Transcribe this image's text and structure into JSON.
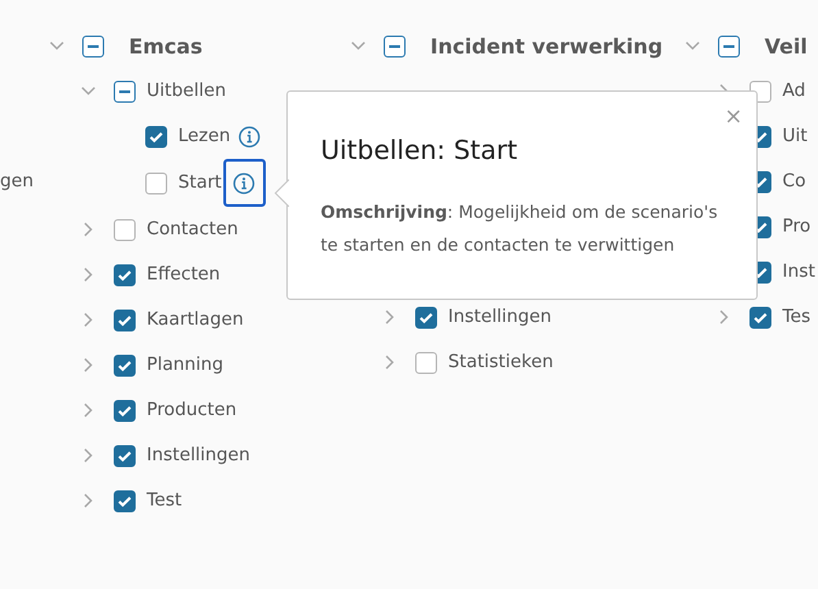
{
  "columns": [
    {
      "items": [
        {
          "label": "gen"
        }
      ]
    },
    {
      "items": [
        {
          "label": "Emcas",
          "indeterminate": true,
          "expanded": true,
          "children": [
            {
              "label": "Uitbellen",
              "indeterminate": true,
              "expanded": true,
              "children": [
                {
                  "label": "Lezen",
                  "checked": true,
                  "info": true,
                  "focused": false
                },
                {
                  "label": "Start",
                  "checked": false,
                  "info": true,
                  "focused": true
                }
              ]
            },
            {
              "label": "Contacten",
              "checked": false,
              "expanded": false
            },
            {
              "label": "Effecten",
              "checked": true,
              "expanded": false
            },
            {
              "label": "Kaartlagen",
              "checked": true,
              "expanded": false
            },
            {
              "label": "Planning",
              "checked": true,
              "expanded": false
            },
            {
              "label": "Producten",
              "checked": true,
              "expanded": false
            },
            {
              "label": "Instellingen",
              "checked": true,
              "expanded": false
            },
            {
              "label": "Test",
              "checked": true,
              "expanded": false
            }
          ]
        }
      ]
    },
    {
      "items": [
        {
          "label": "Incident verwerking",
          "indeterminate": true,
          "expanded": true,
          "children": [
            {
              "label": "Instellingen",
              "checked": true,
              "expanded": false
            },
            {
              "label": "Statistieken",
              "checked": false,
              "expanded": false
            }
          ]
        }
      ]
    },
    {
      "items": [
        {
          "label": "Veil",
          "indeterminate": true,
          "expanded": true,
          "children": [
            {
              "label": "Ad",
              "checked": false,
              "expanded": false
            },
            {
              "label": "Uit",
              "checked": true
            },
            {
              "label": "Co",
              "checked": true
            },
            {
              "label": "Pro",
              "checked": true
            },
            {
              "label": "Inst",
              "checked": true
            },
            {
              "label": "Tes",
              "checked": true,
              "expanded": false
            }
          ]
        }
      ]
    }
  ],
  "popover": {
    "title": "Uitbellen: Start",
    "description_label": "Omschrijving",
    "description": ": Mogelijkheid om de scenario's te starten en de contacten te verwittigen",
    "close": "×"
  }
}
